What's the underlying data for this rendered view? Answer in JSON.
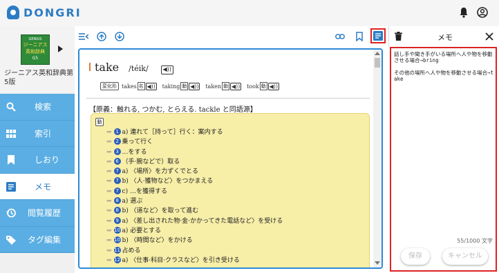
{
  "app": {
    "logo_text": "DONGRI"
  },
  "dictionary": {
    "cover_line1": "GENIUS",
    "cover_line2": "ジーニアス",
    "cover_line3": "英和辞典",
    "cover_line4": "G5",
    "name": "ジーニアス英和辞典第5版"
  },
  "sidebar": {
    "items": [
      {
        "label": "検索",
        "icon": "search-icon"
      },
      {
        "label": "索引",
        "icon": "grid-icon"
      },
      {
        "label": "しおり",
        "icon": "bookmark-icon"
      },
      {
        "label": "メモ",
        "icon": "memo-icon",
        "active": true
      },
      {
        "label": "閲覧履歴",
        "icon": "history-icon"
      },
      {
        "label": "タグ編集",
        "icon": "tag-icon"
      }
    ]
  },
  "entry": {
    "headword": "take",
    "pronunciation": "/téik/",
    "speaker": "◀))",
    "forms_tag": "変化形",
    "forms": [
      {
        "word": "takes",
        "pos": "名"
      },
      {
        "word": "taking",
        "pos": "動"
      },
      {
        "word": "taken",
        "pos": "動"
      },
      {
        "word": "took",
        "pos": "動"
      }
    ],
    "etymology": "【原義：触れる, つかむ, とらえる. tackle と同語源】",
    "pos_marker": "動",
    "arrow": "⇒",
    "senses": [
      {
        "num": "1",
        "text": "a) 連れて［持って］行く：案内する"
      },
      {
        "num": "2",
        "text": "乗って行く"
      },
      {
        "num": "3",
        "text": "…をする"
      },
      {
        "num": "6",
        "text": "（手·腕などで）取る"
      },
      {
        "num": "7",
        "text": "a) 〈場所〉を力ずくでとる"
      },
      {
        "num": "7",
        "text": "b) 〈人·獲物など〉をつかまえる"
      },
      {
        "num": "7",
        "text": "c) …を獲得する"
      },
      {
        "num": "8",
        "text": "a) 選ぶ"
      },
      {
        "num": "8",
        "text": "b) 〈道など〉を取って進む"
      },
      {
        "num": "9",
        "text": "a) 〈差し出された物·金·かかってきた電話など〉を受ける"
      },
      {
        "num": "10",
        "text": "a) 必要とする"
      },
      {
        "num": "10",
        "text": "b) 〈時間など〉をかける"
      },
      {
        "num": "11",
        "text": "占める"
      },
      {
        "num": "12",
        "text": "a) 〈仕事·科目·クラスなど〉を引き受ける"
      }
    ]
  },
  "memo": {
    "title": "メモ",
    "text": "話し手や聞き手がいる場所へ人や物を移動させる場合→bring\n\nその他の場所へ人や物を移動させる場合→take",
    "char_count": "55/1000 文字",
    "save_label": "保存",
    "cancel_label": "キャンセル"
  }
}
